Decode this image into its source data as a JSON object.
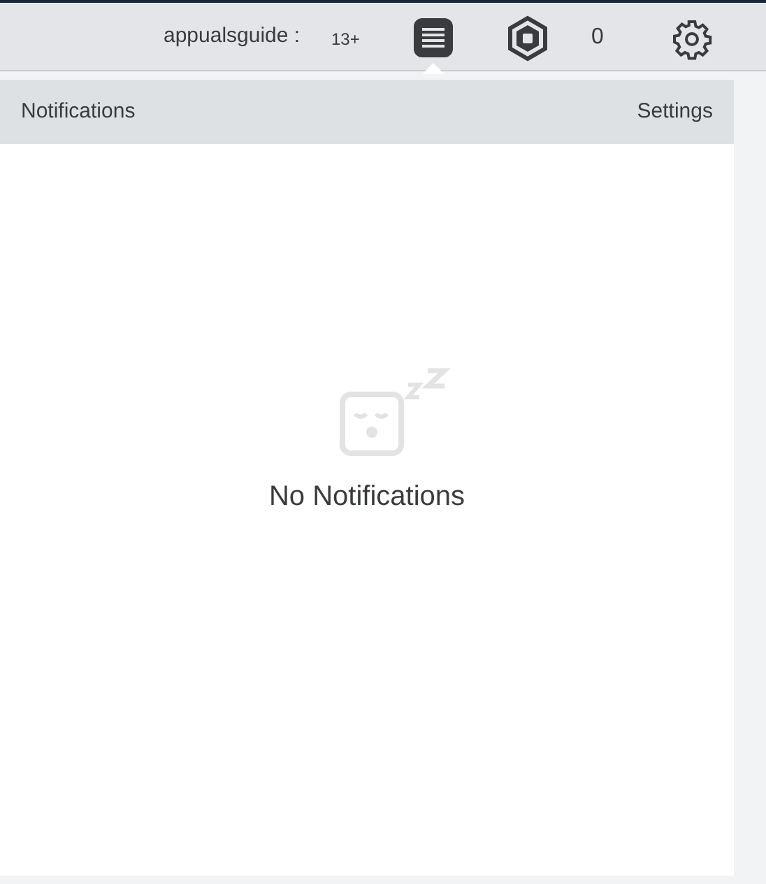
{
  "top_bar": {
    "username": "appualsguide :",
    "age_badge": "13+",
    "notifications_open": true,
    "robux_count": "0"
  },
  "notifications_panel": {
    "title": "Notifications",
    "settings_link": "Settings",
    "empty_message": "No Notifications"
  }
}
